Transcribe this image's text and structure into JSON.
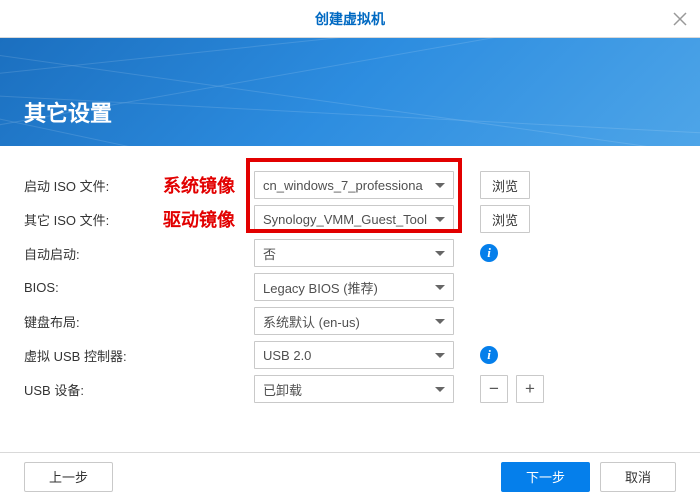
{
  "titlebar": {
    "title": "创建虚拟机"
  },
  "banner": {
    "title": "其它设置"
  },
  "annotations": {
    "system_image": "系统镜像",
    "driver_image": "驱动镜像"
  },
  "form": {
    "boot_iso": {
      "label": "启动 ISO 文件:",
      "value": "cn_windows_7_professiona",
      "browse": "浏览"
    },
    "other_iso": {
      "label": "其它 ISO 文件:",
      "value": "Synology_VMM_Guest_Tool",
      "browse": "浏览"
    },
    "auto_start": {
      "label": "自动启动:",
      "value": "否"
    },
    "bios": {
      "label": "BIOS:",
      "value": "Legacy BIOS (推荐)"
    },
    "keyboard": {
      "label": "键盘布局:",
      "value": "系统默认 (en-us)"
    },
    "usb_controller": {
      "label": "虚拟 USB 控制器:",
      "value": "USB 2.0"
    },
    "usb_device": {
      "label": "USB 设备:",
      "value": "已卸载"
    }
  },
  "footer": {
    "prev": "上一步",
    "next": "下一步",
    "cancel": "取消"
  },
  "colors": {
    "accent": "#057feb",
    "annotation": "#e20000"
  }
}
